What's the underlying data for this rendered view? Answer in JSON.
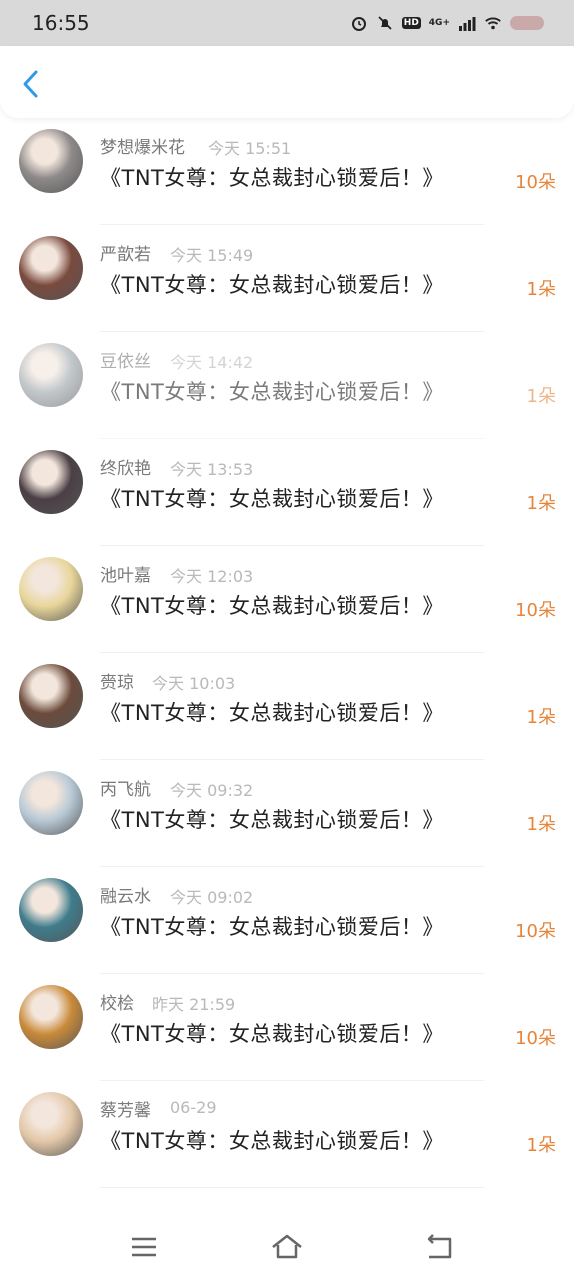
{
  "status_bar": {
    "time": "16:55",
    "network": "4G+",
    "hd_label": "HD"
  },
  "header": {
    "back_icon": "chevron-left-icon",
    "accent_color": "#2f9be6"
  },
  "items": [
    {
      "name": "梦想爆米花",
      "time": "今天 15:51",
      "title": "《TNT女尊：女总裁封心锁爱后！》",
      "amount": "10朵",
      "avatar_color": "#8e8a8a",
      "dim": false
    },
    {
      "name": "严歆若",
      "time": "今天 15:49",
      "title": "《TNT女尊：女总裁封心锁爱后！》",
      "amount": "1朵",
      "avatar_color": "#7a4a3e",
      "dim": false
    },
    {
      "name": "豆依丝",
      "time": "今天 14:42",
      "title": "《TNT女尊：女总裁封心锁爱后！》",
      "amount": "1朵",
      "avatar_color": "#9aa3a8",
      "dim": true
    },
    {
      "name": "终欣艳",
      "time": "今天 13:53",
      "title": "《TNT女尊：女总裁封心锁爱后！》",
      "amount": "1朵",
      "avatar_color": "#4a3f45",
      "dim": false
    },
    {
      "name": "池叶嘉",
      "time": "今天 12:03",
      "title": "《TNT女尊：女总裁封心锁爱后！》",
      "amount": "10朵",
      "avatar_color": "#e8d69a",
      "dim": false
    },
    {
      "name": "赍琼",
      "time": "今天 10:03",
      "title": "《TNT女尊：女总裁封心锁爱后！》",
      "amount": "1朵",
      "avatar_color": "#6b4b3c",
      "dim": false
    },
    {
      "name": "丙飞航",
      "time": "今天 09:32",
      "title": "《TNT女尊：女总裁封心锁爱后！》",
      "amount": "1朵",
      "avatar_color": "#b8c9d6",
      "dim": false
    },
    {
      "name": "融云水",
      "time": "今天 09:02",
      "title": "《TNT女尊：女总裁封心锁爱后！》",
      "amount": "10朵",
      "avatar_color": "#3f7c8c",
      "dim": false
    },
    {
      "name": "校桧",
      "time": "昨天 21:59",
      "title": "《TNT女尊：女总裁封心锁爱后！》",
      "amount": "10朵",
      "avatar_color": "#c98a3a",
      "dim": false
    },
    {
      "name": "蔡芳馨",
      "time": "06-29",
      "title": "《TNT女尊：女总裁封心锁爱后！》",
      "amount": "1朵",
      "avatar_color": "#e3c7a8",
      "dim": false
    }
  ],
  "nav_bar": {
    "menu_icon": "menu-icon",
    "home_icon": "home-icon",
    "back_icon": "back-icon"
  }
}
